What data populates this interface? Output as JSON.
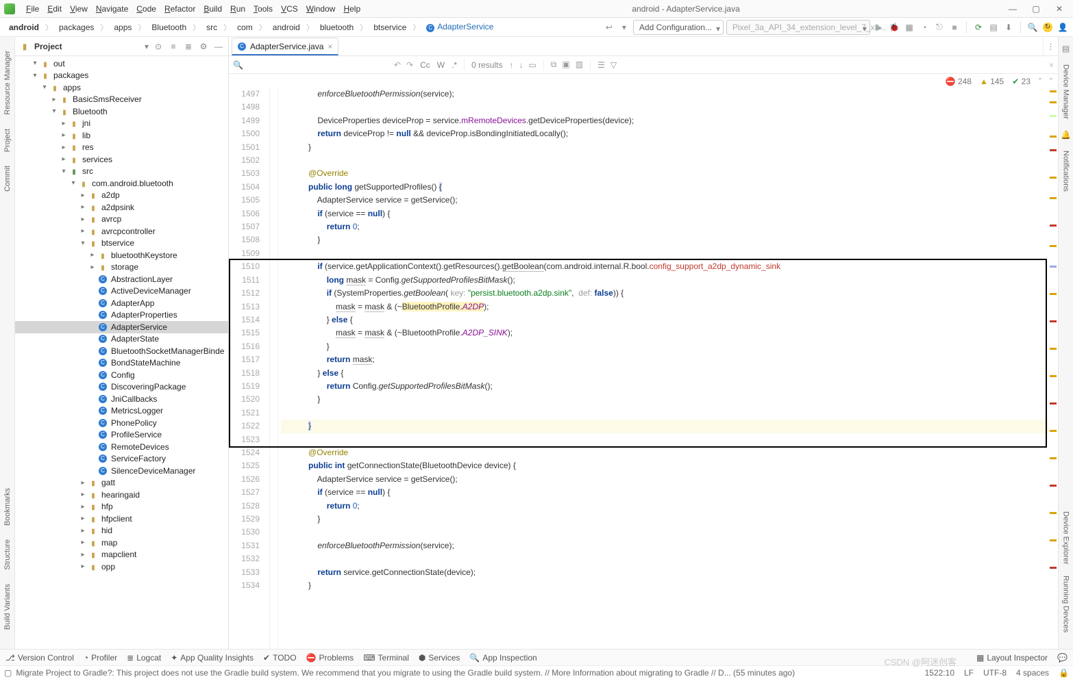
{
  "window_title": "android - AdapterService.java",
  "menus": [
    "File",
    "Edit",
    "View",
    "Navigate",
    "Code",
    "Refactor",
    "Build",
    "Run",
    "Tools",
    "VCS",
    "Window",
    "Help"
  ],
  "breadcrumbs": [
    "android",
    "packages",
    "apps",
    "Bluetooth",
    "src",
    "com",
    "android",
    "bluetooth",
    "btservice",
    "AdapterService"
  ],
  "run_config_label": "Add Configuration...",
  "device_select_label": "Pixel_3a_API_34_extension_level_7_x8...",
  "project_label": "Project",
  "tree": [
    {
      "d": 1,
      "a": "▾",
      "i": "folder",
      "t": "out"
    },
    {
      "d": 1,
      "a": "▾",
      "i": "folder",
      "t": "packages"
    },
    {
      "d": 2,
      "a": "▾",
      "i": "folder",
      "t": "apps"
    },
    {
      "d": 3,
      "a": "▸",
      "i": "folder",
      "t": "BasicSmsReceiver"
    },
    {
      "d": 3,
      "a": "▾",
      "i": "folder",
      "t": "Bluetooth"
    },
    {
      "d": 4,
      "a": "▸",
      "i": "folder",
      "t": "jni"
    },
    {
      "d": 4,
      "a": "▸",
      "i": "folder",
      "t": "lib"
    },
    {
      "d": 4,
      "a": "▸",
      "i": "folder",
      "t": "res"
    },
    {
      "d": 4,
      "a": "▸",
      "i": "folder",
      "t": "services"
    },
    {
      "d": 4,
      "a": "▾",
      "i": "src",
      "t": "src"
    },
    {
      "d": 5,
      "a": "▾",
      "i": "folder",
      "t": "com.android.bluetooth"
    },
    {
      "d": 6,
      "a": "▸",
      "i": "folder",
      "t": "a2dp"
    },
    {
      "d": 6,
      "a": "▸",
      "i": "folder",
      "t": "a2dpsink"
    },
    {
      "d": 6,
      "a": "▸",
      "i": "folder",
      "t": "avrcp"
    },
    {
      "d": 6,
      "a": "▸",
      "i": "folder",
      "t": "avrcpcontroller"
    },
    {
      "d": 6,
      "a": "▾",
      "i": "folder",
      "t": "btservice"
    },
    {
      "d": 7,
      "a": "▸",
      "i": "folder",
      "t": "bluetoothKeystore"
    },
    {
      "d": 7,
      "a": "▸",
      "i": "folder",
      "t": "storage"
    },
    {
      "d": 7,
      "a": "",
      "i": "cls",
      "t": "AbstractionLayer"
    },
    {
      "d": 7,
      "a": "",
      "i": "cls",
      "t": "ActiveDeviceManager"
    },
    {
      "d": 7,
      "a": "",
      "i": "cls",
      "t": "AdapterApp"
    },
    {
      "d": 7,
      "a": "",
      "i": "cls",
      "t": "AdapterProperties"
    },
    {
      "d": 7,
      "a": "",
      "i": "cls",
      "t": "AdapterService",
      "sel": true
    },
    {
      "d": 7,
      "a": "",
      "i": "cls",
      "t": "AdapterState"
    },
    {
      "d": 7,
      "a": "",
      "i": "cls",
      "t": "BluetoothSocketManagerBinde"
    },
    {
      "d": 7,
      "a": "",
      "i": "cls",
      "t": "BondStateMachine"
    },
    {
      "d": 7,
      "a": "",
      "i": "cls",
      "t": "Config"
    },
    {
      "d": 7,
      "a": "",
      "i": "cls",
      "t": "DiscoveringPackage"
    },
    {
      "d": 7,
      "a": "",
      "i": "cls",
      "t": "JniCallbacks"
    },
    {
      "d": 7,
      "a": "",
      "i": "cls",
      "t": "MetricsLogger"
    },
    {
      "d": 7,
      "a": "",
      "i": "cls",
      "t": "PhonePolicy"
    },
    {
      "d": 7,
      "a": "",
      "i": "cls",
      "t": "ProfileService"
    },
    {
      "d": 7,
      "a": "",
      "i": "cls",
      "t": "RemoteDevices"
    },
    {
      "d": 7,
      "a": "",
      "i": "cls",
      "t": "ServiceFactory"
    },
    {
      "d": 7,
      "a": "",
      "i": "cls",
      "t": "SilenceDeviceManager"
    },
    {
      "d": 6,
      "a": "▸",
      "i": "folder",
      "t": "gatt"
    },
    {
      "d": 6,
      "a": "▸",
      "i": "folder",
      "t": "hearingaid"
    },
    {
      "d": 6,
      "a": "▸",
      "i": "folder",
      "t": "hfp"
    },
    {
      "d": 6,
      "a": "▸",
      "i": "folder",
      "t": "hfpclient"
    },
    {
      "d": 6,
      "a": "▸",
      "i": "folder",
      "t": "hid"
    },
    {
      "d": 6,
      "a": "▸",
      "i": "folder",
      "t": "map"
    },
    {
      "d": 6,
      "a": "▸",
      "i": "folder",
      "t": "mapclient"
    },
    {
      "d": 6,
      "a": "▸",
      "i": "folder",
      "t": "opp"
    }
  ],
  "editor_tab": "AdapterService.java",
  "find": {
    "placeholder": "",
    "results": "0 results",
    "cc": "Cc",
    "w": "W",
    "regex": ".*"
  },
  "inspections": {
    "errors": "248",
    "warnings": "145",
    "oks": "23"
  },
  "code_lines": [
    {
      "n": 1497,
      "html": "                <span class='fnc'>enforceBluetoothPermission</span>(service);"
    },
    {
      "n": 1498,
      "html": ""
    },
    {
      "n": 1499,
      "html": "                DeviceProperties deviceProp = service.<span class='fld'>mRemoteDevices</span>.getDeviceProperties(device);"
    },
    {
      "n": 1500,
      "html": "                <span class='kw'>return</span> deviceProp != <span class='kw'>null</span> && deviceProp.isBondingInitiatedLocally();"
    },
    {
      "n": 1501,
      "html": "            }"
    },
    {
      "n": 1502,
      "html": ""
    },
    {
      "n": 1503,
      "html": "            <span class='ann'>@Override</span>"
    },
    {
      "n": 1504,
      "html": "            <span class='kw'>public</span> <span class='kw'>long</span> getSupportedProfiles() <span class='sel'>{</span>"
    },
    {
      "n": 1505,
      "html": "                AdapterService service = getService();"
    },
    {
      "n": 1506,
      "html": "                <span class='kw'>if</span> (service == <span class='kw'>null</span>) {"
    },
    {
      "n": 1507,
      "html": "                    <span class='kw'>return</span> <span class='num'>0</span>;"
    },
    {
      "n": 1508,
      "html": "                }"
    },
    {
      "n": 1509,
      "html": ""
    },
    {
      "n": 1510,
      "html": "                <span class='kw'>if</span> (service.getApplicationContext().getResources().<span class='hl-var'>getBoolean</span>(com.android.internal.R.bool.<span class='err-t'>config_support_a2dp_dynamic_sink</span>"
    },
    {
      "n": 1511,
      "html": "                    <span class='kw'>long</span> <span class='hl-var'>mask</span> = Config.<span class='fnc'>getSupportedProfilesBitMask</span>();"
    },
    {
      "n": 1512,
      "html": "                    <span class='kw'>if</span> (SystemProperties.<span class='fnc'>getBoolean</span>( <span class='hint'>key:</span> <span class='str'>\"persist.bluetooth.a2dp.sink\"</span>,  <span class='hint'>def:</span> <span class='kw'>false</span>)) {"
    },
    {
      "n": 1513,
      "html": "                        <span class='hl-var'>mask</span> = <span class='hl-var'>mask</span> & (~<span class='hl-a2dp'>BluetoothProfile.</span><span class='hl-a2dp' style='font-style:italic;color:#871094'>A2DP</span>);"
    },
    {
      "n": 1514,
      "html": "                    } <span class='kw'>else</span> {"
    },
    {
      "n": 1515,
      "html": "                        <span class='hl-var'>mask</span> = <span class='hl-var'>mask</span> & (~BluetoothProfile.<span class='hl-sink'>A2DP_SINK</span>);"
    },
    {
      "n": 1516,
      "html": "                    }"
    },
    {
      "n": 1517,
      "html": "                    <span class='kw'>return</span> <span class='hl-var'>mask</span>;"
    },
    {
      "n": 1518,
      "html": "                } <span class='kw'>else</span> {"
    },
    {
      "n": 1519,
      "html": "                    <span class='kw'>return</span> Config.<span class='fnc'>getSupportedProfilesBitMask</span>();"
    },
    {
      "n": 1520,
      "html": "                }"
    },
    {
      "n": 1521,
      "html": ""
    },
    {
      "n": 1522,
      "html": "            <span class='sel'>}</span>",
      "cl": "cursor-line"
    },
    {
      "n": 1523,
      "html": ""
    },
    {
      "n": 1524,
      "html": "            <span class='ann'>@Override</span>"
    },
    {
      "n": 1525,
      "html": "            <span class='kw'>public</span> <span class='kw'>int</span> getConnectionState(BluetoothDevice device) {"
    },
    {
      "n": 1526,
      "html": "                AdapterService service = getService();"
    },
    {
      "n": 1527,
      "html": "                <span class='kw'>if</span> (service == <span class='kw'>null</span>) {"
    },
    {
      "n": 1528,
      "html": "                    <span class='kw'>return</span> <span class='num'>0</span>;"
    },
    {
      "n": 1529,
      "html": "                }"
    },
    {
      "n": 1530,
      "html": ""
    },
    {
      "n": 1531,
      "html": "                <span class='fnc'>enforceBluetoothPermission</span>(service);"
    },
    {
      "n": 1532,
      "html": ""
    },
    {
      "n": 1533,
      "html": "                <span class='kw'>return</span> service.getConnectionState(device);"
    },
    {
      "n": 1534,
      "html": "            }"
    }
  ],
  "box_overlay": {
    "top_line": 1510,
    "bottom_line": 1523
  },
  "left_rail": [
    "Resource Manager",
    "Project",
    "Commit",
    "Bookmarks",
    "Structure",
    "Build Variants"
  ],
  "right_rail": [
    "Device Manager",
    "Notifications",
    "Device Explorer",
    "Running Devices"
  ],
  "bottom_tools": {
    "version_control": "Version Control",
    "profiler": "Profiler",
    "logcat": "Logcat",
    "app_quality": "App Quality Insights",
    "todo": "TODO",
    "problems": "Problems",
    "terminal": "Terminal",
    "services": "Services",
    "app_inspection": "App Inspection",
    "layout_inspector": "Layout Inspector"
  },
  "status": {
    "msg": "Migrate Project to Gradle?: This project does not use the Gradle build system. We recommend that you migrate to using the Gradle build system. // More Information about migrating to Gradle // D... (55 minutes ago)",
    "pos": "1522:10",
    "lf": "LF",
    "enc": "UTF-8",
    "indent": "4 spaces"
  },
  "watermark": "CSDN @阿迷创客"
}
